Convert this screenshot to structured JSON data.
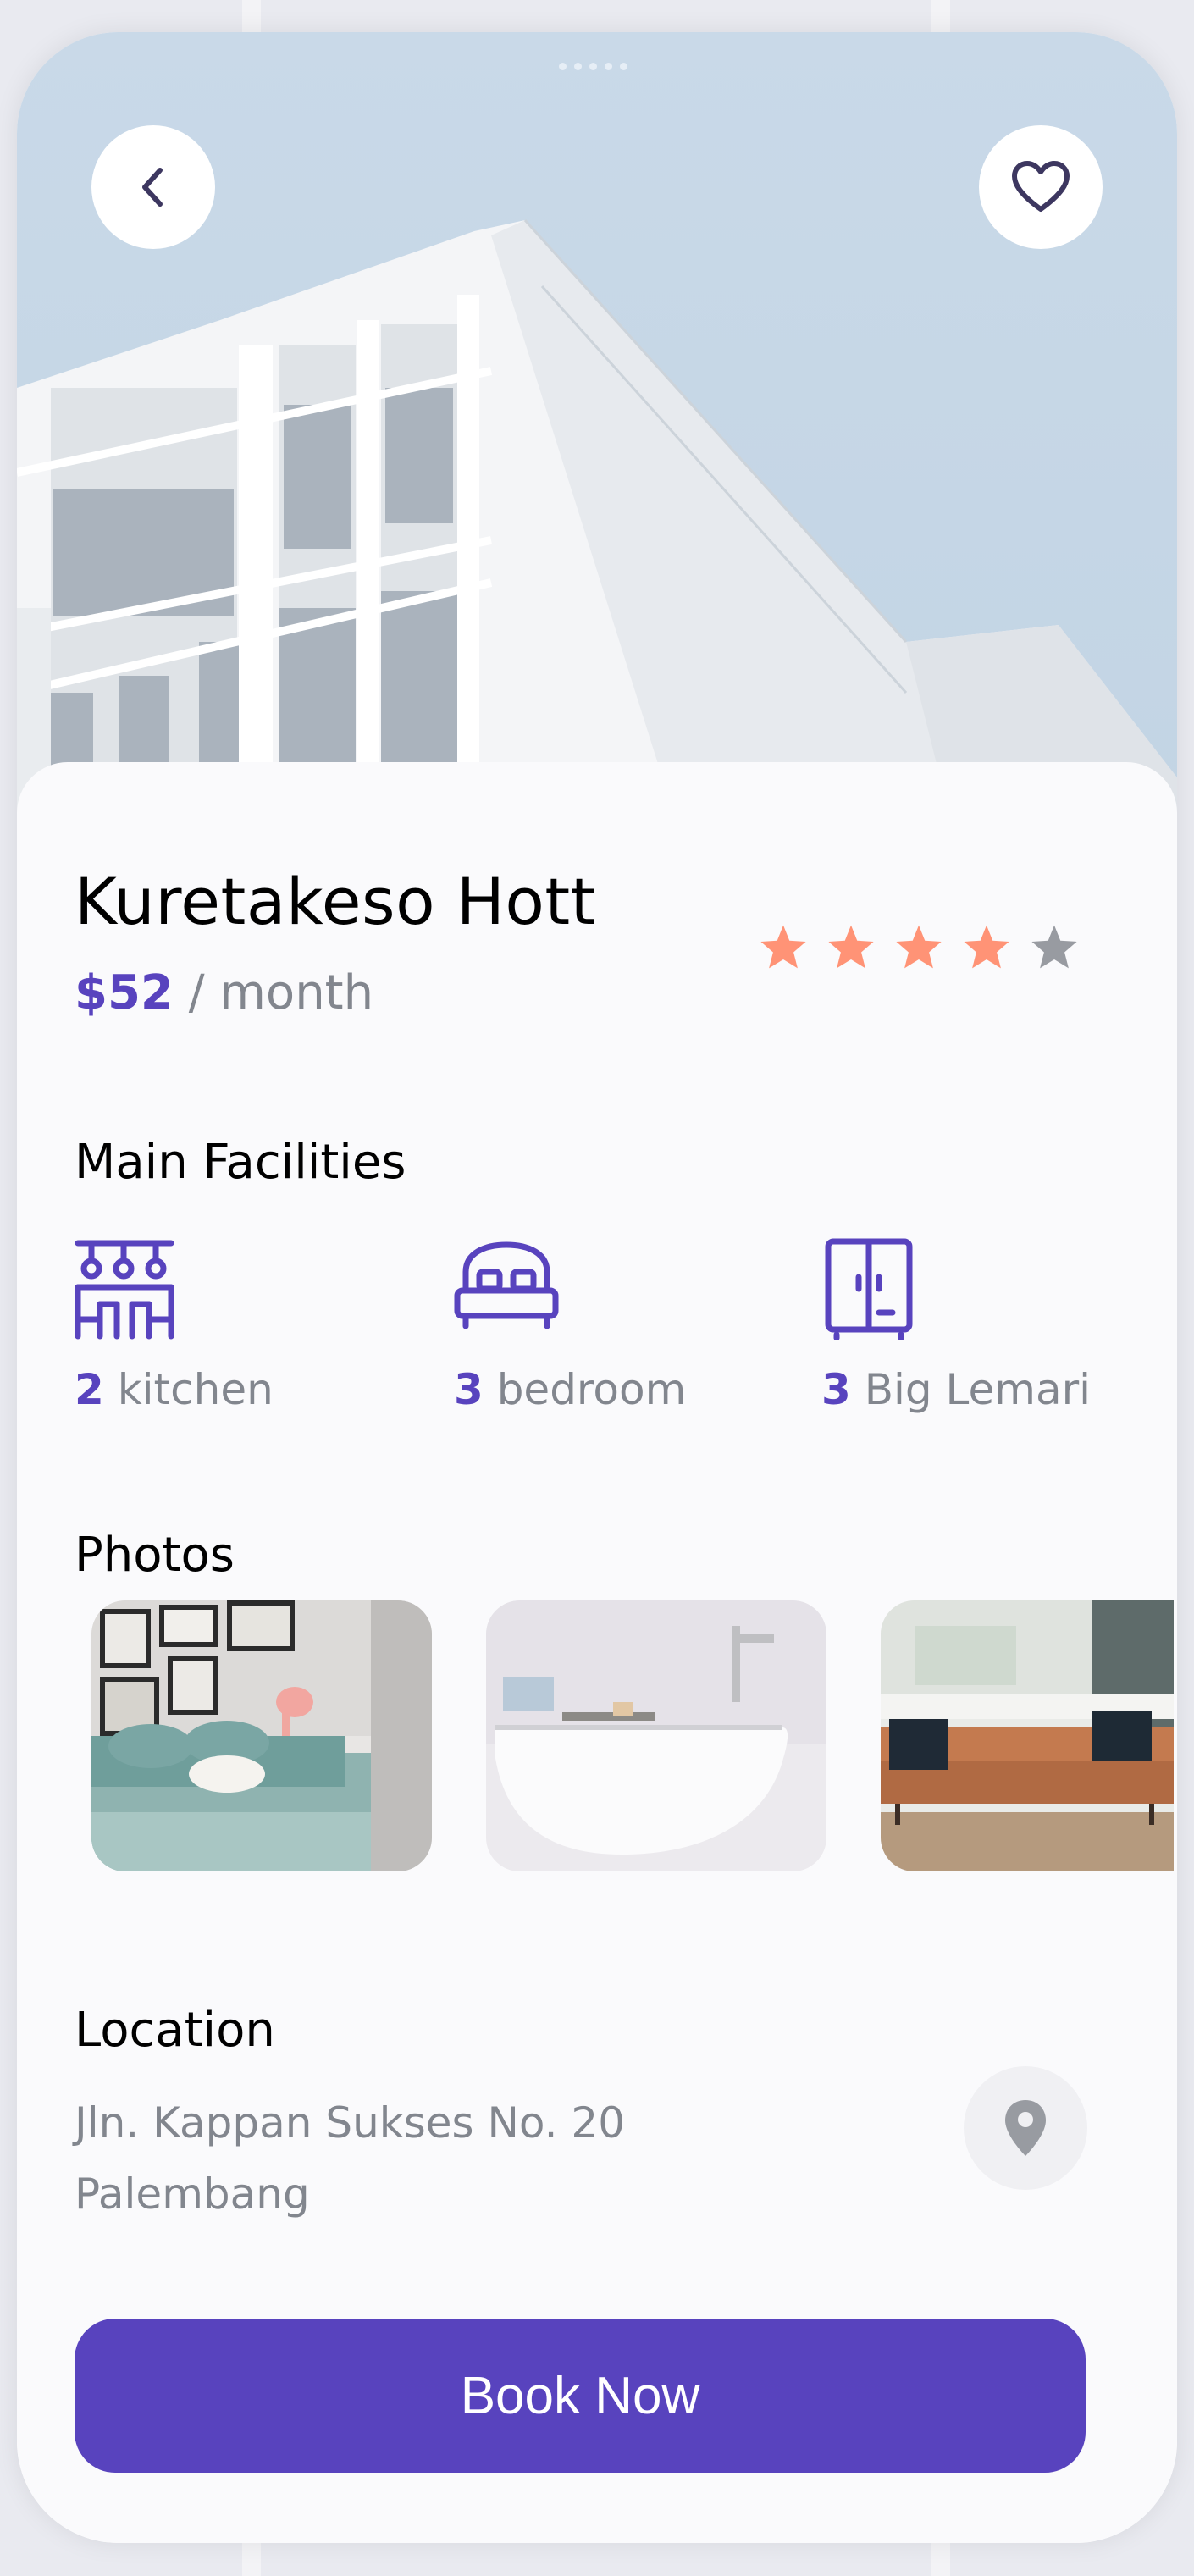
{
  "property": {
    "name": "Kuretakeso Hott",
    "price_amount": "$52",
    "price_period": " / month",
    "rating": 4,
    "rating_max": 5
  },
  "facilities": {
    "heading": "Main Facilities",
    "items": [
      {
        "count": "2",
        "label": " kitchen",
        "icon": "kitchen-icon"
      },
      {
        "count": "3",
        "label": " bedroom",
        "icon": "bed-icon"
      },
      {
        "count": "3",
        "label": " Big Lemari",
        "icon": "wardrobe-icon"
      }
    ]
  },
  "photos": {
    "heading": "Photos",
    "items": [
      "bedroom-photo",
      "bathtub-photo",
      "living-room-photo"
    ]
  },
  "location": {
    "heading": "Location",
    "address_line1": "Jln. Kappan Sukses No. 20",
    "address_line2": "Palembang"
  },
  "actions": {
    "book_label": "Book Now"
  },
  "colors": {
    "accent": "#5843be",
    "star_active": "#ff9376",
    "star_inactive": "#989ba1",
    "muted_text": "#82868e"
  }
}
